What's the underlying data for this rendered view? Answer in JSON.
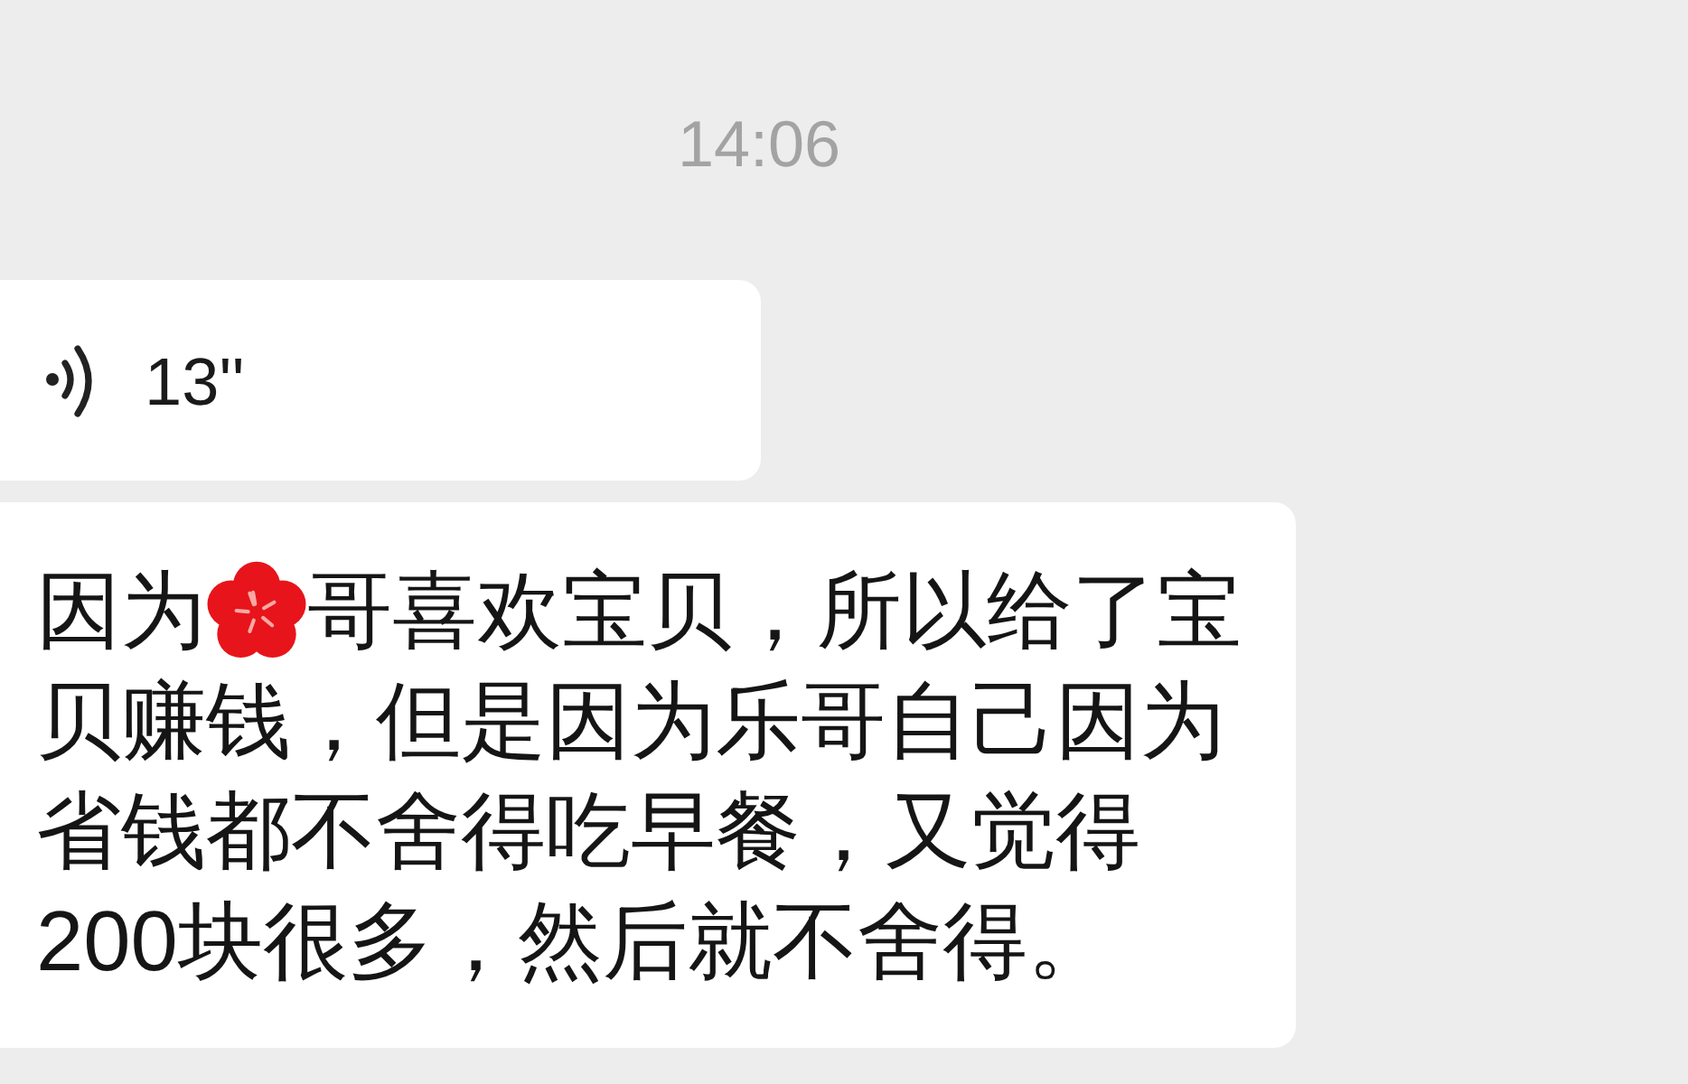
{
  "timestamp": "14:06",
  "messages": [
    {
      "kind": "voice",
      "duration": "13''"
    },
    {
      "kind": "text",
      "lines": [
        [
          {
            "kind": "text",
            "text": "因为"
          },
          {
            "kind": "sticker"
          },
          {
            "kind": "text",
            "text": "哥喜欢宝贝，所以给了宝"
          }
        ],
        [
          {
            "kind": "text",
            "text": "贝赚钱，但是因为乐哥自己因为"
          }
        ],
        [
          {
            "kind": "text",
            "text": "省钱都不舍得吃早餐，又觉得"
          }
        ],
        [
          {
            "kind": "text",
            "text": "200块很多，然后就不舍得。"
          }
        ]
      ]
    }
  ]
}
